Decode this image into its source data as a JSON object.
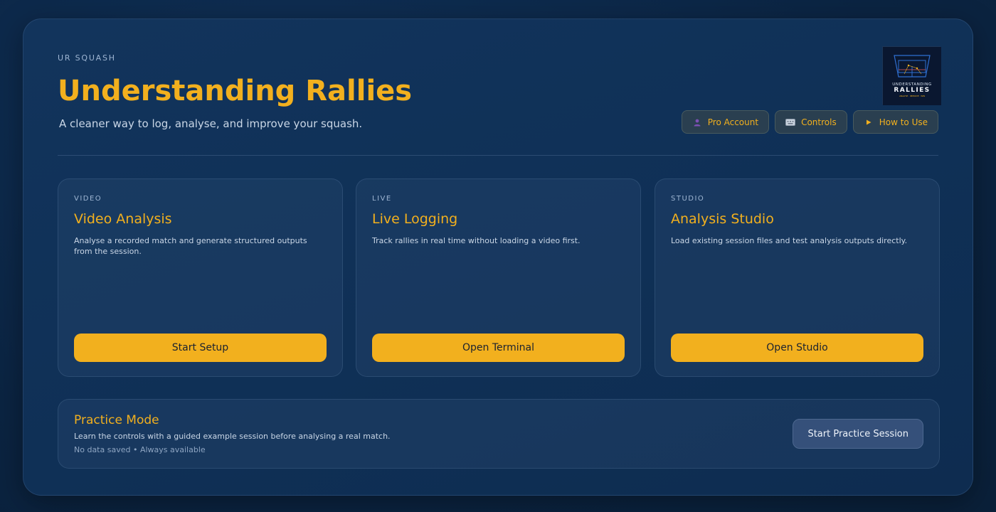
{
  "header": {
    "eyebrow": "UR SQUASH",
    "title": "Understanding Rallies",
    "subtitle": "A cleaner way to log, analyse, and improve your squash.",
    "logo": {
      "line1": "UNDERSTANDING",
      "line2": "RALLIES",
      "tagline": "ANALYSE · IMPROVE · WIN"
    },
    "actions": [
      {
        "label": "Pro Account",
        "icon": "user-icon"
      },
      {
        "label": "Controls",
        "icon": "keyboard-icon"
      },
      {
        "label": "How to Use",
        "icon": "play-icon"
      }
    ]
  },
  "cards": [
    {
      "kicker": "VIDEO",
      "title": "Video Analysis",
      "description": "Analyse a recorded match and generate structured outputs from the session.",
      "button": "Start Setup"
    },
    {
      "kicker": "LIVE",
      "title": "Live Logging",
      "description": "Track rallies in real time without loading a video first.",
      "button": "Open Terminal"
    },
    {
      "kicker": "STUDIO",
      "title": "Analysis Studio",
      "description": "Load existing session files and test analysis outputs directly.",
      "button": "Open Studio"
    }
  ],
  "practice": {
    "title": "Practice Mode",
    "description": "Learn the controls with a guided example session before analysing a real match.",
    "meta": "No data saved • Always available",
    "button": "Start Practice Session"
  },
  "colors": {
    "accent": "#f2b01e",
    "background": "#0b2442",
    "panel": "#12345c"
  }
}
